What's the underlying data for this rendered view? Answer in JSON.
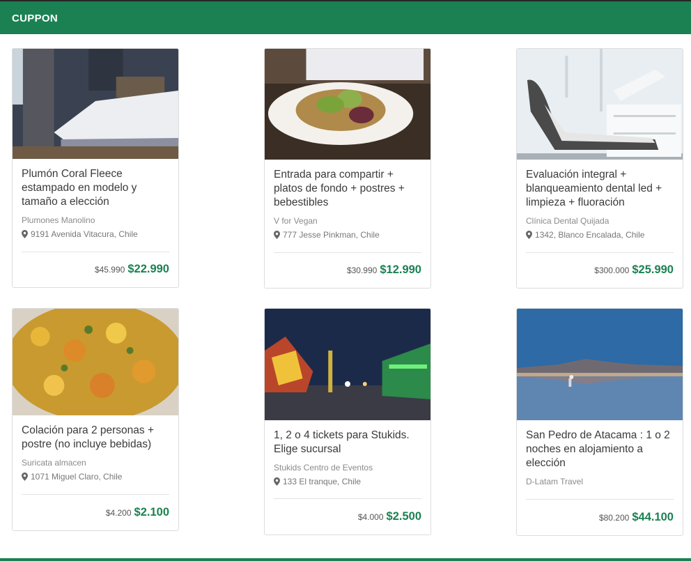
{
  "header": {
    "brand": "CUPPON",
    "brand_color": "#1b8152"
  },
  "deals": [
    {
      "image": "bedroom-photo",
      "title": "Plumón Coral Fleece estampado en modelo y tamaño a elección",
      "vendor": "Plumones Manolino",
      "address": "9191 Avenida Vitacura, Chile",
      "old_price": "$45.990",
      "new_price": "$22.990"
    },
    {
      "image": "salad-plate-photo",
      "title": "Entrada para compartir + platos de fondo + postres + bebestibles",
      "vendor": "V for Vegan",
      "address": "777 Jesse Pinkman, Chile",
      "old_price": "$30.990",
      "new_price": "$12.990"
    },
    {
      "image": "dental-chair-photo",
      "title": "Evaluación integral + blanqueamiento dental led + limpieza + fluoración",
      "vendor": "Clínica Dental Quijada",
      "address": "1342, Blanco Encalada, Chile",
      "old_price": "$300.000",
      "new_price": "$25.990"
    },
    {
      "image": "food-dish-photo",
      "title": "Colación para 2 personas + postre (no incluye bebidas)",
      "vendor": "Suricata almacen",
      "address": "1071 Miguel Claro, Chile",
      "old_price": "$4.200",
      "new_price": "$2.100"
    },
    {
      "image": "amusement-park-photo",
      "title": "1, 2 o 4 tickets para Stukids. Elige sucursal",
      "vendor": "Stukids Centro de Eventos",
      "address": "133 El tranque, Chile",
      "old_price": "$4.000",
      "new_price": "$2.500"
    },
    {
      "image": "atacama-lake-photo",
      "title": "San Pedro de Atacama : 1 o 2 noches en alojamiento a elección",
      "vendor": "D-Latam Travel",
      "address": "",
      "old_price": "$80.200",
      "new_price": "$44.100"
    }
  ]
}
